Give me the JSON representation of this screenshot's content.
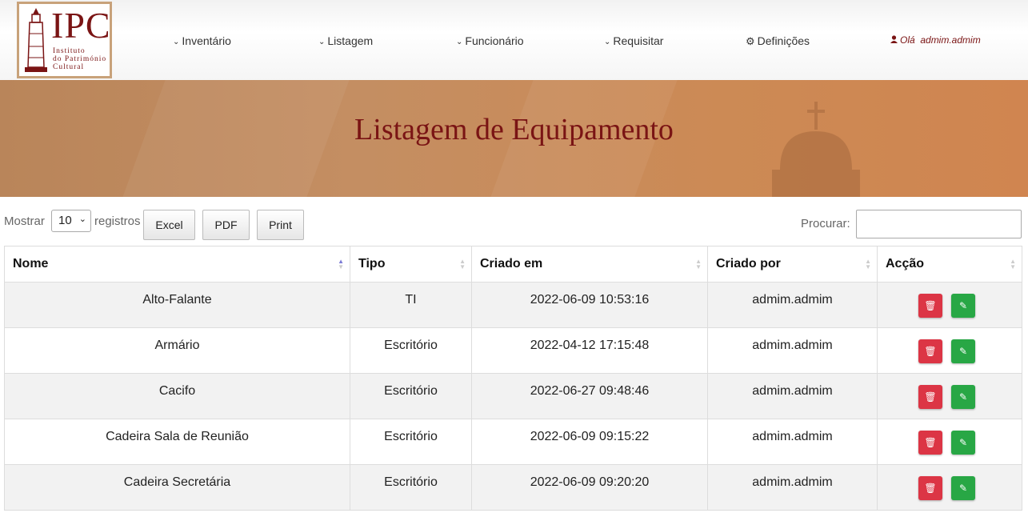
{
  "logo": {
    "acronym": "IPC",
    "line1": "Instituto",
    "line2": "do Património",
    "line3": "Cultural"
  },
  "nav": [
    {
      "label": "Inventário",
      "icon": "chevron-down-icon"
    },
    {
      "label": "Listagem",
      "icon": "chevron-down-icon"
    },
    {
      "label": "Funcionário",
      "icon": "chevron-down-icon"
    },
    {
      "label": "Requisitar",
      "icon": "chevron-down-icon"
    },
    {
      "label": "Definições",
      "icon": "gear-icon"
    }
  ],
  "user": {
    "greeting": "Olá  admim.admim",
    "icon": "user-icon"
  },
  "banner": {
    "title": "Listagem de Equipamento"
  },
  "controls": {
    "show_label": "Mostrar",
    "page_size": "10",
    "records_label": "registros",
    "excel": "Excel",
    "pdf": "PDF",
    "print": "Print",
    "search_label": "Procurar:",
    "search_value": ""
  },
  "table": {
    "columns": [
      "Nome",
      "Tipo",
      "Criado em",
      "Criado por",
      "Acção"
    ],
    "rows": [
      {
        "nome": "Alto-Falante",
        "tipo": "TI",
        "criado_em": "2022-06-09 10:53:16",
        "criado_por": "admim.admim"
      },
      {
        "nome": "Armário",
        "tipo": "Escritório",
        "criado_em": "2022-04-12 17:15:48",
        "criado_por": "admim.admim"
      },
      {
        "nome": "Cacifo",
        "tipo": "Escritório",
        "criado_em": "2022-06-27 09:48:46",
        "criado_por": "admim.admim"
      },
      {
        "nome": "Cadeira Sala de Reunião",
        "tipo": "Escritório",
        "criado_em": "2022-06-09 09:15:22",
        "criado_por": "admim.admim"
      },
      {
        "nome": "Cadeira Secretária",
        "tipo": "Escritório",
        "criado_em": "2022-06-09 09:20:20",
        "criado_por": "admim.admim"
      }
    ],
    "actions": {
      "delete_icon": "trash-icon",
      "edit_icon": "edit-icon"
    }
  },
  "colors": {
    "brand": "#7a1414",
    "delete": "#dc3545",
    "edit": "#28a745",
    "banner": "#c48e62"
  }
}
